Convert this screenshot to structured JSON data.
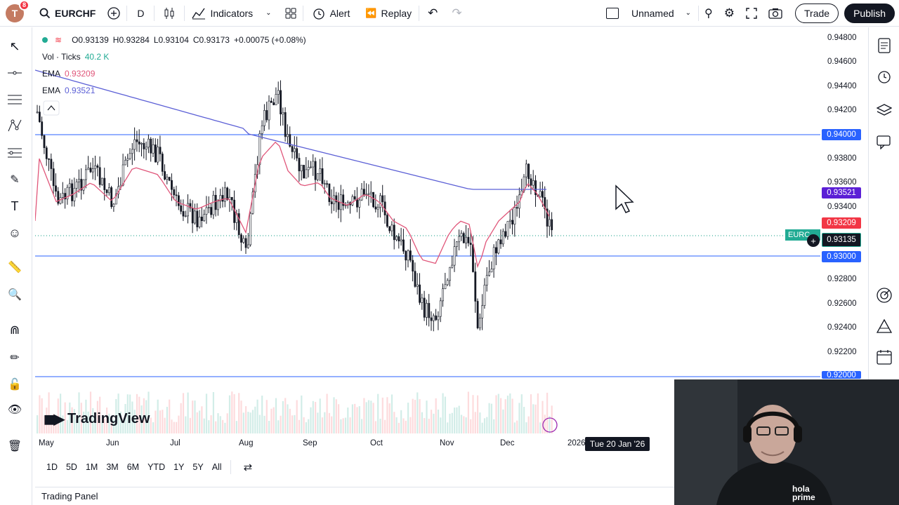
{
  "topbar": {
    "avatar_letter": "T",
    "notification_count": "8",
    "symbol": "EURCHF",
    "interval": "D",
    "indicators_label": "Indicators",
    "alert_label": "Alert",
    "replay_label": "Replay",
    "layout_name": "Unnamed",
    "trade_label": "Trade",
    "publish_label": "Publish"
  },
  "legend": {
    "ohlc": {
      "o": "O0.93139",
      "h": "H0.93284",
      "l": "L0.93104",
      "c": "C0.93173",
      "change": "+0.00075 (+0.08%)"
    },
    "vol_label": "Vol · Ticks",
    "vol_value": "40.2 K",
    "ema1_label": "EMA",
    "ema1_value": "0.93209",
    "ema2_label": "EMA",
    "ema2_value": "0.93521"
  },
  "price_axis": {
    "ticks": [
      "0.94800",
      "0.94600",
      "0.94400",
      "0.94200",
      "0.94000",
      "0.93800",
      "0.93600",
      "0.93521",
      "0.93400",
      "0.93209",
      "0.93135",
      "0.93000",
      "0.92800",
      "0.92600",
      "0.92400",
      "0.92200",
      "0.92000"
    ],
    "tag_094000": "0.94000",
    "tag_ema2": "0.93521",
    "tag_ema1": "0.93209",
    "tag_last": "0.93135",
    "tag_093000": "0.93000",
    "tag_092000": "0.92000",
    "symbol_tag": "EURC"
  },
  "time_axis": {
    "labels": [
      "May",
      "Jun",
      "Jul",
      "Aug",
      "Sep",
      "Oct",
      "Nov",
      "Dec",
      "2026"
    ],
    "crosshair_date": "Tue 20 Jan '26"
  },
  "ranges": [
    "1D",
    "5D",
    "1M",
    "3M",
    "6M",
    "YTD",
    "1Y",
    "5Y",
    "All"
  ],
  "panel_label": "Trading Panel",
  "brand": "TradingView",
  "webcam_logo": "hola prime",
  "colors": {
    "ema_fast": "#e0567a",
    "ema_slow": "#5b5fd6",
    "hline": "#2962ff",
    "last_price": "#089981",
    "publish_bg": "#131722"
  }
}
